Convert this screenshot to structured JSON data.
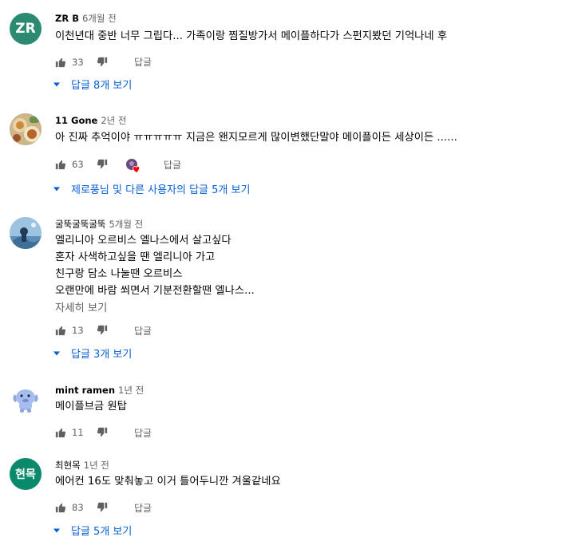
{
  "comments": [
    {
      "author": "ZR B",
      "time": "6개월 전",
      "avatar_text": "ZR",
      "avatar_color": "#2d8a72",
      "lines": [
        "이천년대 중반 너무 그립다...  가족이랑 찜질방가서 메이플하다가 스펀지봤던 기억나네 후"
      ],
      "likes": "33",
      "reply_label": "답글",
      "replies_label": "답글 8개 보기"
    },
    {
      "author": "11 Gone",
      "time": "2년 전",
      "lines": [
        "아 진짜 추억이야 ㅠㅠㅠㅠㅠ 지금은 왠지모르게 많이변했단말야 메이플이든 세상이든 ......"
      ],
      "likes": "63",
      "reply_label": "답글",
      "replies_label": "제로풍님 및 다른 사용자의 답글 5개 보기"
    },
    {
      "author": "굴뚝굴뚝굴뚝",
      "time": "5개월 전",
      "lines": [
        "엘리니아 오르비스 엘나스에서 살고싶다",
        "혼자 사색하고싶을 땐 엘리니아 가고",
        "친구랑 담소 나눌땐 오르비스",
        "오랜만에 바람 쐬면서 기분전환할땐 엘나스..."
      ],
      "more_label": "자세히 보기",
      "likes": "13",
      "reply_label": "답글",
      "replies_label": "답글 3개 보기"
    },
    {
      "author": "mint ramen",
      "time": "1년 전",
      "lines": [
        "메이플브금 원탑"
      ],
      "likes": "11",
      "reply_label": "답글"
    },
    {
      "author": "최현목",
      "time": "1년 전",
      "avatar_text": "현목",
      "avatar_color": "#0b8a6b",
      "lines": [
        "에어컨 16도 맞춰놓고 이거 틀어두니깐 겨울같네요"
      ],
      "likes": "83",
      "reply_label": "답글",
      "replies_label": "답글 5개 보기"
    }
  ],
  "colors": {
    "link_blue": "#065fd4",
    "secondary_text": "#606060",
    "icon_gray": "#606060"
  }
}
